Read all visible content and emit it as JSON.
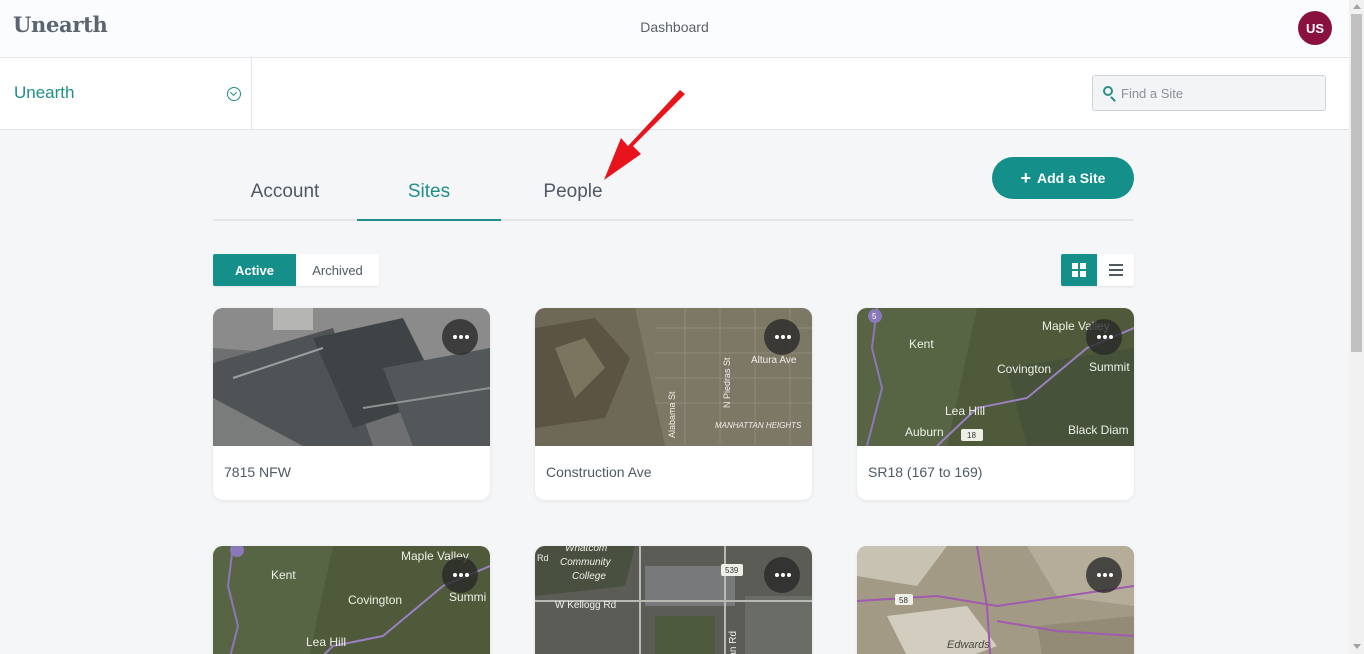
{
  "app": {
    "logo": "Unearth",
    "header_title": "Dashboard",
    "user_initials": "US"
  },
  "org": {
    "name": "Unearth"
  },
  "search": {
    "placeholder": "Find a Site"
  },
  "tabs": [
    {
      "label": "Account"
    },
    {
      "label": "Sites"
    },
    {
      "label": "People"
    }
  ],
  "active_tab": "Sites",
  "add_site": {
    "label": "Add a Site"
  },
  "filter": {
    "active_label": "Active",
    "archived_label": "Archived",
    "selected": "Active"
  },
  "view": {
    "selected": "grid"
  },
  "colors": {
    "accent": "#148f89",
    "avatar": "#8a1040",
    "arrow": "#e8141c"
  },
  "sites": [
    {
      "name": "7815 NFW",
      "map_labels": []
    },
    {
      "name": "Construction Ave",
      "map_labels": [
        "Altura Ave",
        "N Piedras St",
        "MANHATTAN HEIGHTS",
        "Alabama St"
      ]
    },
    {
      "name": "SR18 (167 to 169)",
      "map_labels": [
        "Maple Valley",
        "Kent",
        "Covington",
        "Summit",
        "Lea Hill",
        "Auburn",
        "18",
        "Black Diam",
        "5"
      ]
    },
    {
      "name": "",
      "map_labels": [
        "Maple Valley",
        "Kent",
        "Covington",
        "Summi",
        "Lea Hill"
      ]
    },
    {
      "name": "",
      "map_labels": [
        "Whatcom",
        "Community",
        "College",
        "539",
        "W Kellogg Rd",
        "ridian Rd",
        "Rd"
      ]
    },
    {
      "name": "",
      "map_labels": [
        "58",
        "Edwards"
      ]
    }
  ]
}
